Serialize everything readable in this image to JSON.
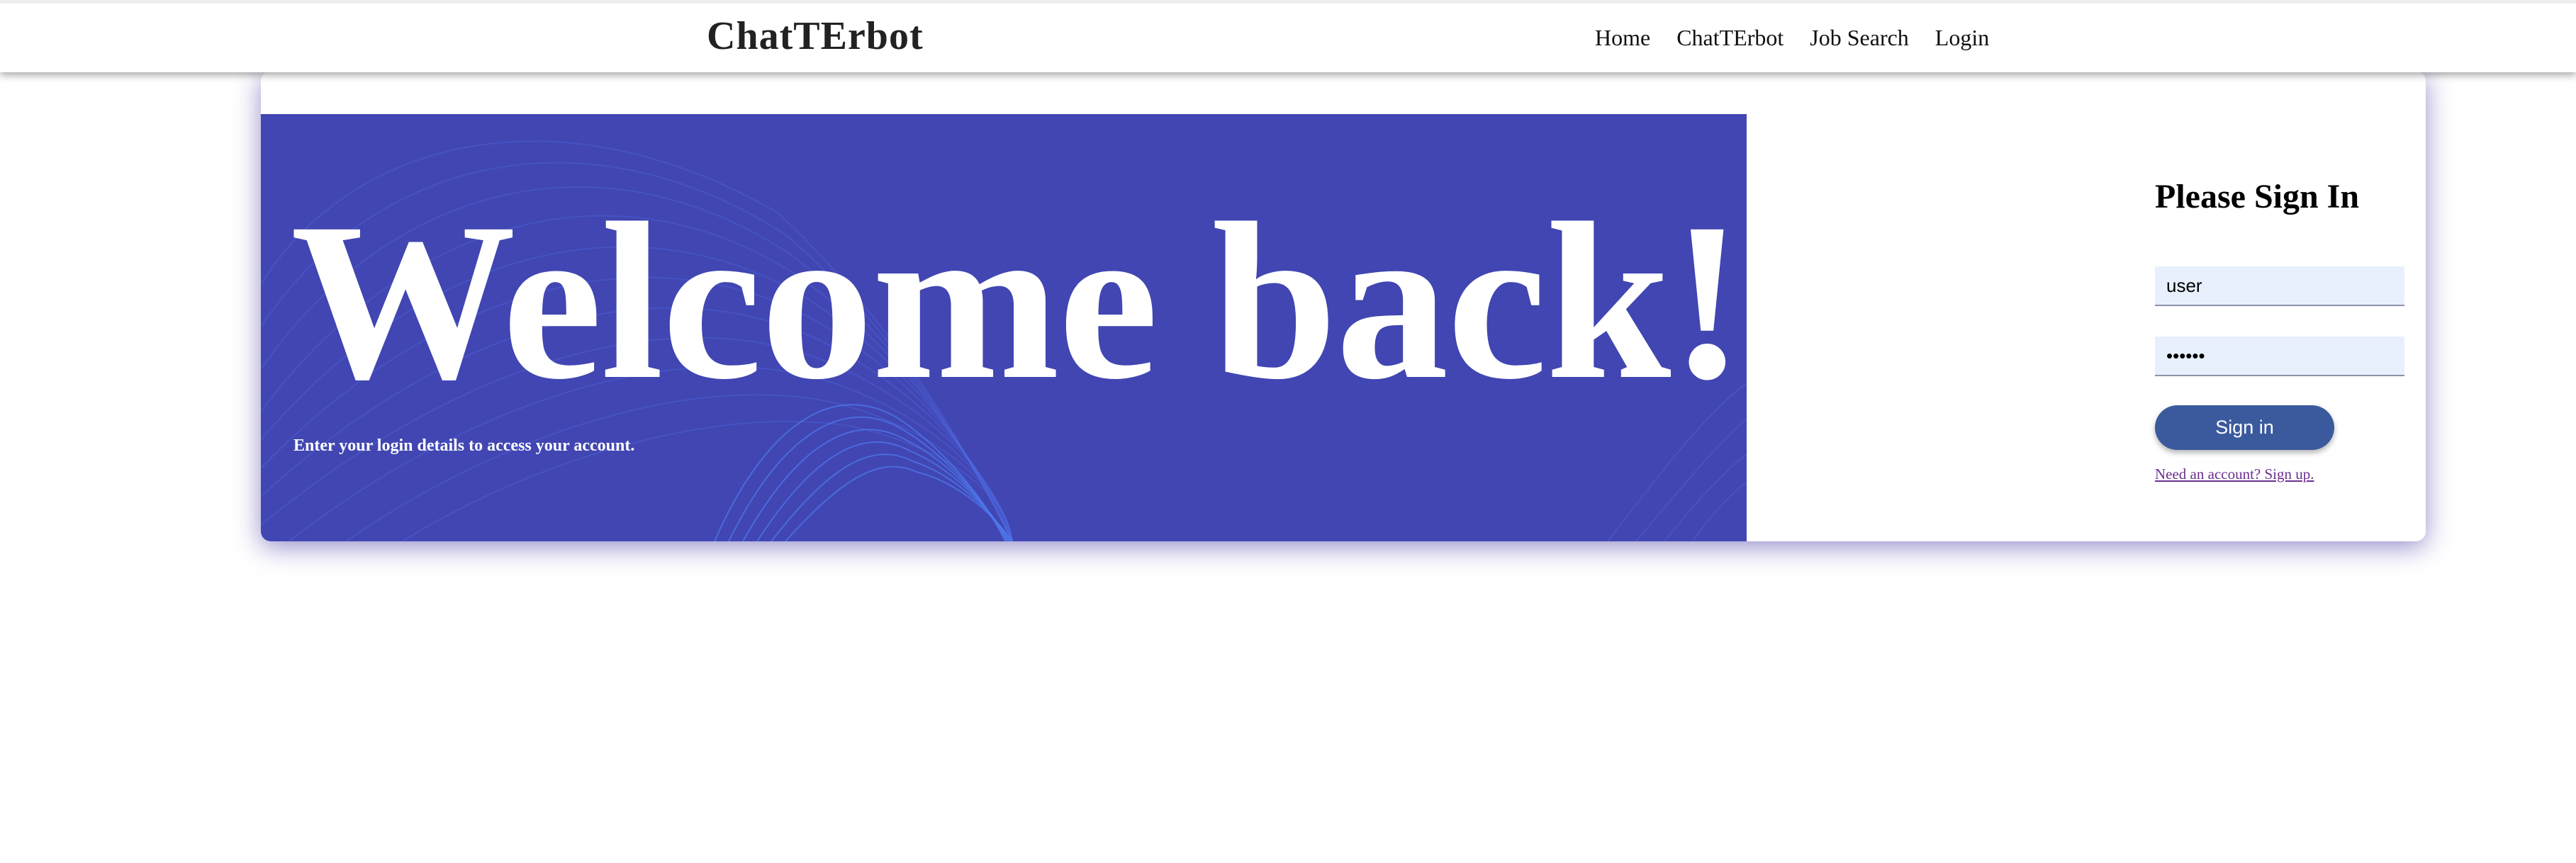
{
  "header": {
    "brand": "ChatTErbot",
    "nav": [
      {
        "label": "Home"
      },
      {
        "label": "ChatTErbot"
      },
      {
        "label": "Job Search"
      },
      {
        "label": "Login"
      }
    ]
  },
  "hero": {
    "title": "Welcome back!",
    "subtitle": "Enter your login details to access your account."
  },
  "signin": {
    "title": "Please Sign In",
    "username_value": "user",
    "password_value": "••••••",
    "button_label": "Sign in",
    "signup_link": "Need an account? Sign up."
  },
  "colors": {
    "hero_background": "#4146b2",
    "wave_lines": "#4f6de6",
    "button": "#3b5a9d",
    "input_background": "#e8f0fe",
    "link": "#6b2f8f"
  }
}
